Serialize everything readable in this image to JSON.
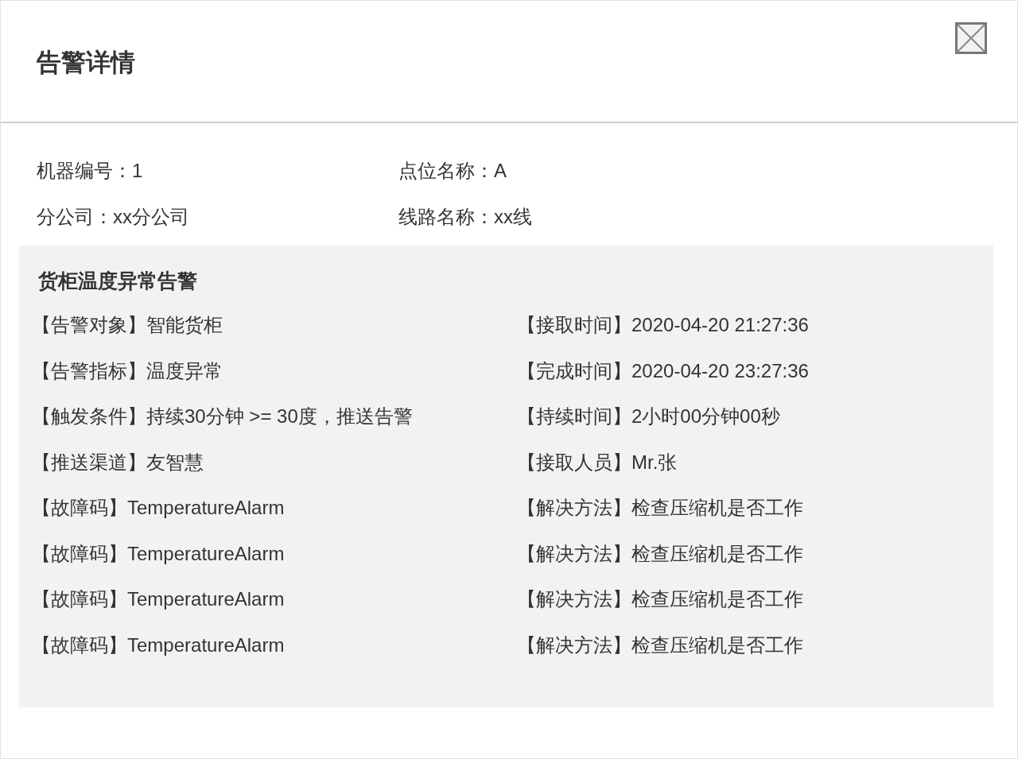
{
  "dialog": {
    "title": "告警详情"
  },
  "info": [
    {
      "label": "机器编号：",
      "value": "1"
    },
    {
      "label": "点位名称：",
      "value": "A"
    },
    {
      "label": "分公司：",
      "value": "xx分公司"
    },
    {
      "label": "线路名称：",
      "value": "xx线"
    }
  ],
  "alarm": {
    "title": "货柜温度异常告警",
    "rows": [
      {
        "left": {
          "label": "【告警对象】",
          "value": "智能货柜"
        },
        "right": {
          "label": "【接取时间】",
          "value": "2020-04-20 21:27:36"
        }
      },
      {
        "left": {
          "label": "【告警指标】",
          "value": "温度异常"
        },
        "right": {
          "label": "【完成时间】",
          "value": "2020-04-20 23:27:36"
        }
      },
      {
        "left": {
          "label": "【触发条件】",
          "value": "持续30分钟 >= 30度，推送告警"
        },
        "right": {
          "label": "【持续时间】",
          "value": "2小时00分钟00秒"
        }
      },
      {
        "left": {
          "label": "【推送渠道】",
          "value": "友智慧"
        },
        "right": {
          "label": "【接取人员】",
          "value": "Mr.张"
        }
      },
      {
        "left": {
          "label": "【故障码】",
          "value": "TemperatureAlarm"
        },
        "right": {
          "label": "【解决方法】",
          "value": "检查压缩机是否工作"
        }
      },
      {
        "left": {
          "label": "【故障码】",
          "value": "TemperatureAlarm"
        },
        "right": {
          "label": "【解决方法】",
          "value": "检查压缩机是否工作"
        }
      },
      {
        "left": {
          "label": "【故障码】",
          "value": "TemperatureAlarm"
        },
        "right": {
          "label": "【解决方法】",
          "value": "检查压缩机是否工作"
        }
      },
      {
        "left": {
          "label": "【故障码】",
          "value": "TemperatureAlarm"
        },
        "right": {
          "label": "【解决方法】",
          "value": "检查压缩机是否工作"
        }
      }
    ]
  }
}
